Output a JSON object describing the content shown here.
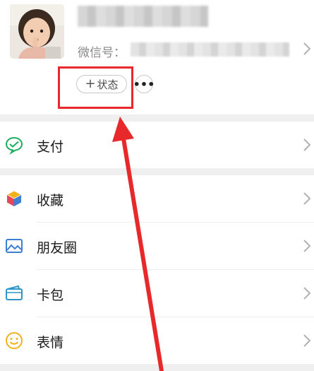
{
  "profile": {
    "wechat_id_label": "微信号：",
    "status_button_plus": "+",
    "status_button_label": "状态",
    "more_button_label": "•••"
  },
  "menu": {
    "pay": "支付",
    "favorites": "收藏",
    "moments": "朋友圈",
    "cards": "卡包",
    "stickers": "表情"
  },
  "colors": {
    "annotation_red": "#e8292b",
    "pay_green": "#1aad5b",
    "moments_blue": "#3e7fd6",
    "cards_blue": "#2f95c9",
    "stickers_yellow": "#f2b21c"
  }
}
